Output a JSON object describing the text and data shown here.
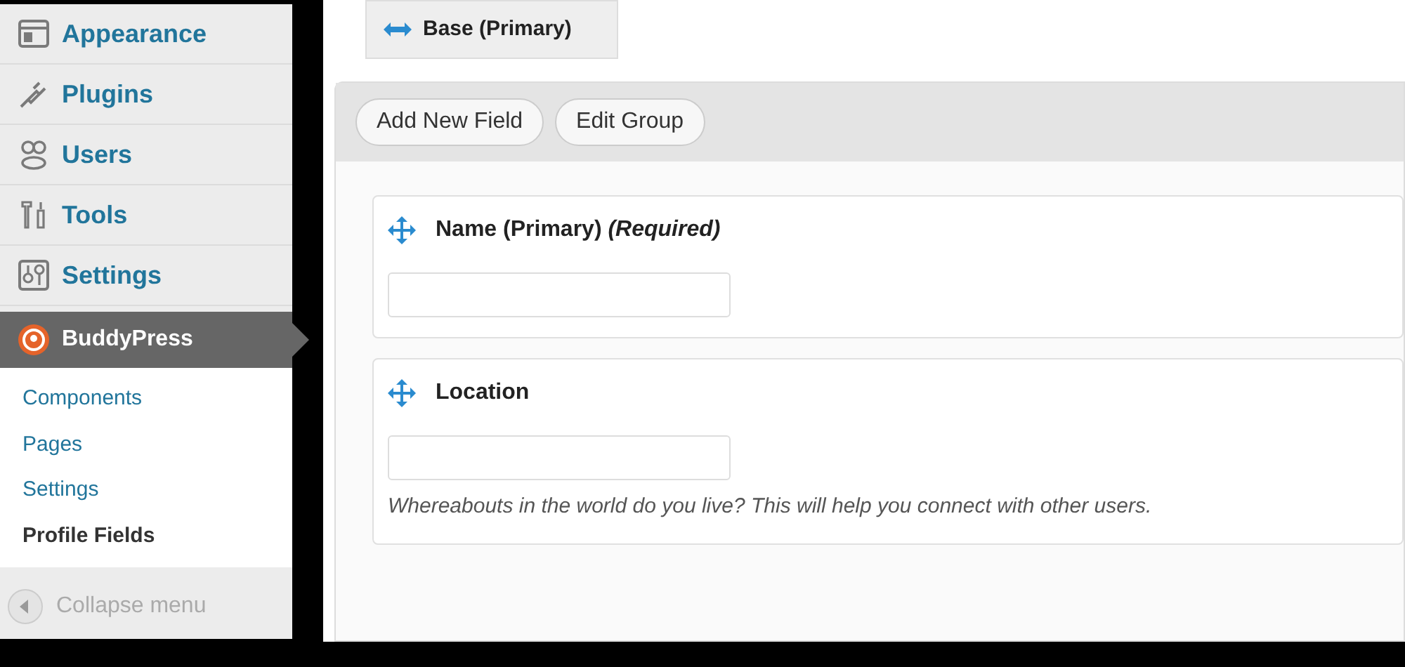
{
  "menu": [
    {
      "label": "Appearance",
      "kind": "appearance",
      "selected": false
    },
    {
      "label": "Plugins",
      "kind": "plugins",
      "selected": false
    },
    {
      "label": "Users",
      "kind": "users",
      "selected": false
    },
    {
      "label": "Tools",
      "kind": "tools",
      "selected": false
    },
    {
      "label": "Settings",
      "kind": "settings",
      "selected": false
    },
    {
      "label": "BuddyPress",
      "kind": "buddypress",
      "selected": true
    }
  ],
  "submenu": [
    {
      "label": "Components",
      "selected": false
    },
    {
      "label": "Pages",
      "selected": false
    },
    {
      "label": "Settings",
      "selected": false
    },
    {
      "label": "Profile Fields",
      "selected": true
    }
  ],
  "collapse": {
    "label": "Collapse menu"
  },
  "group_tab": {
    "label": "Base (Primary)"
  },
  "buttons": [
    "Add New Field",
    "Edit Group"
  ],
  "fields": [
    {
      "label": "Name (Primary) *(Required)*"
    },
    {
      "label": "Location",
      "description": "Whereabouts in the world do you live? This will help you connect with other users."
    }
  ]
}
